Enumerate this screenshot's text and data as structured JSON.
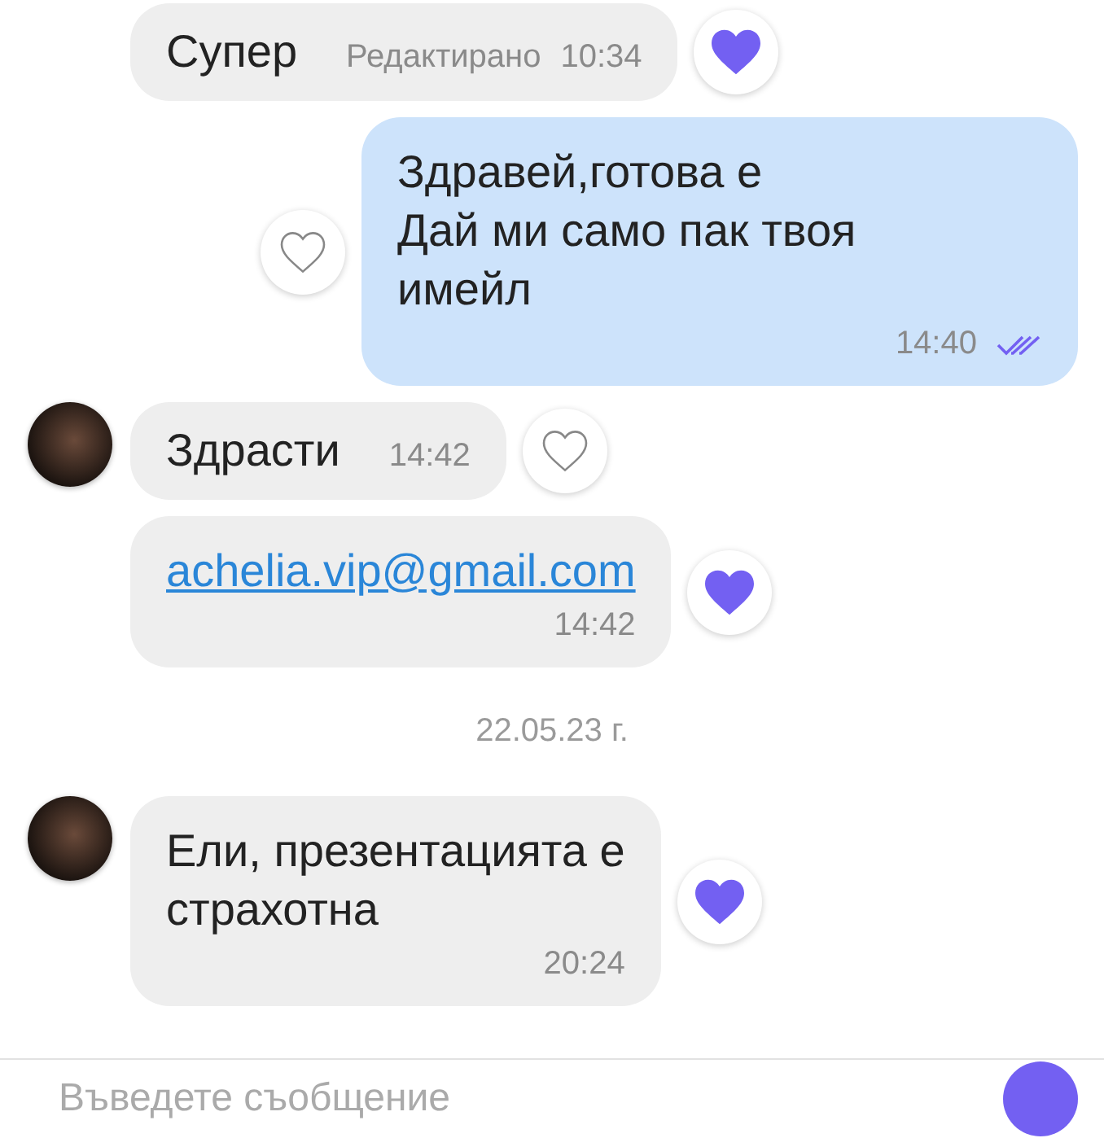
{
  "messages": [
    {
      "kind": "incoming",
      "avatar": false,
      "text": "Супер",
      "edited": "Редактирано",
      "time": "10:34",
      "link": false,
      "time_below": false,
      "liked": true
    },
    {
      "kind": "outgoing",
      "text": "Здравей,готова е\nДай ми само пак твоя\nимейл",
      "time": "14:40",
      "read": true,
      "liked": false
    },
    {
      "kind": "incoming",
      "avatar": true,
      "text": "Здрасти",
      "time": "14:42",
      "link": false,
      "time_below": false,
      "liked": false
    },
    {
      "kind": "incoming",
      "avatar": false,
      "text": "achelia.vip@gmail.com",
      "time": "14:42",
      "link": true,
      "time_below": true,
      "liked": true
    },
    {
      "kind": "date",
      "text": "22.05.23 г."
    },
    {
      "kind": "incoming",
      "avatar": true,
      "text": "Ели, презентацията е\nстрахотна",
      "time": "20:24",
      "link": false,
      "time_below": true,
      "liked": true
    }
  ],
  "composer": {
    "placeholder": "Въведете съобщение"
  }
}
